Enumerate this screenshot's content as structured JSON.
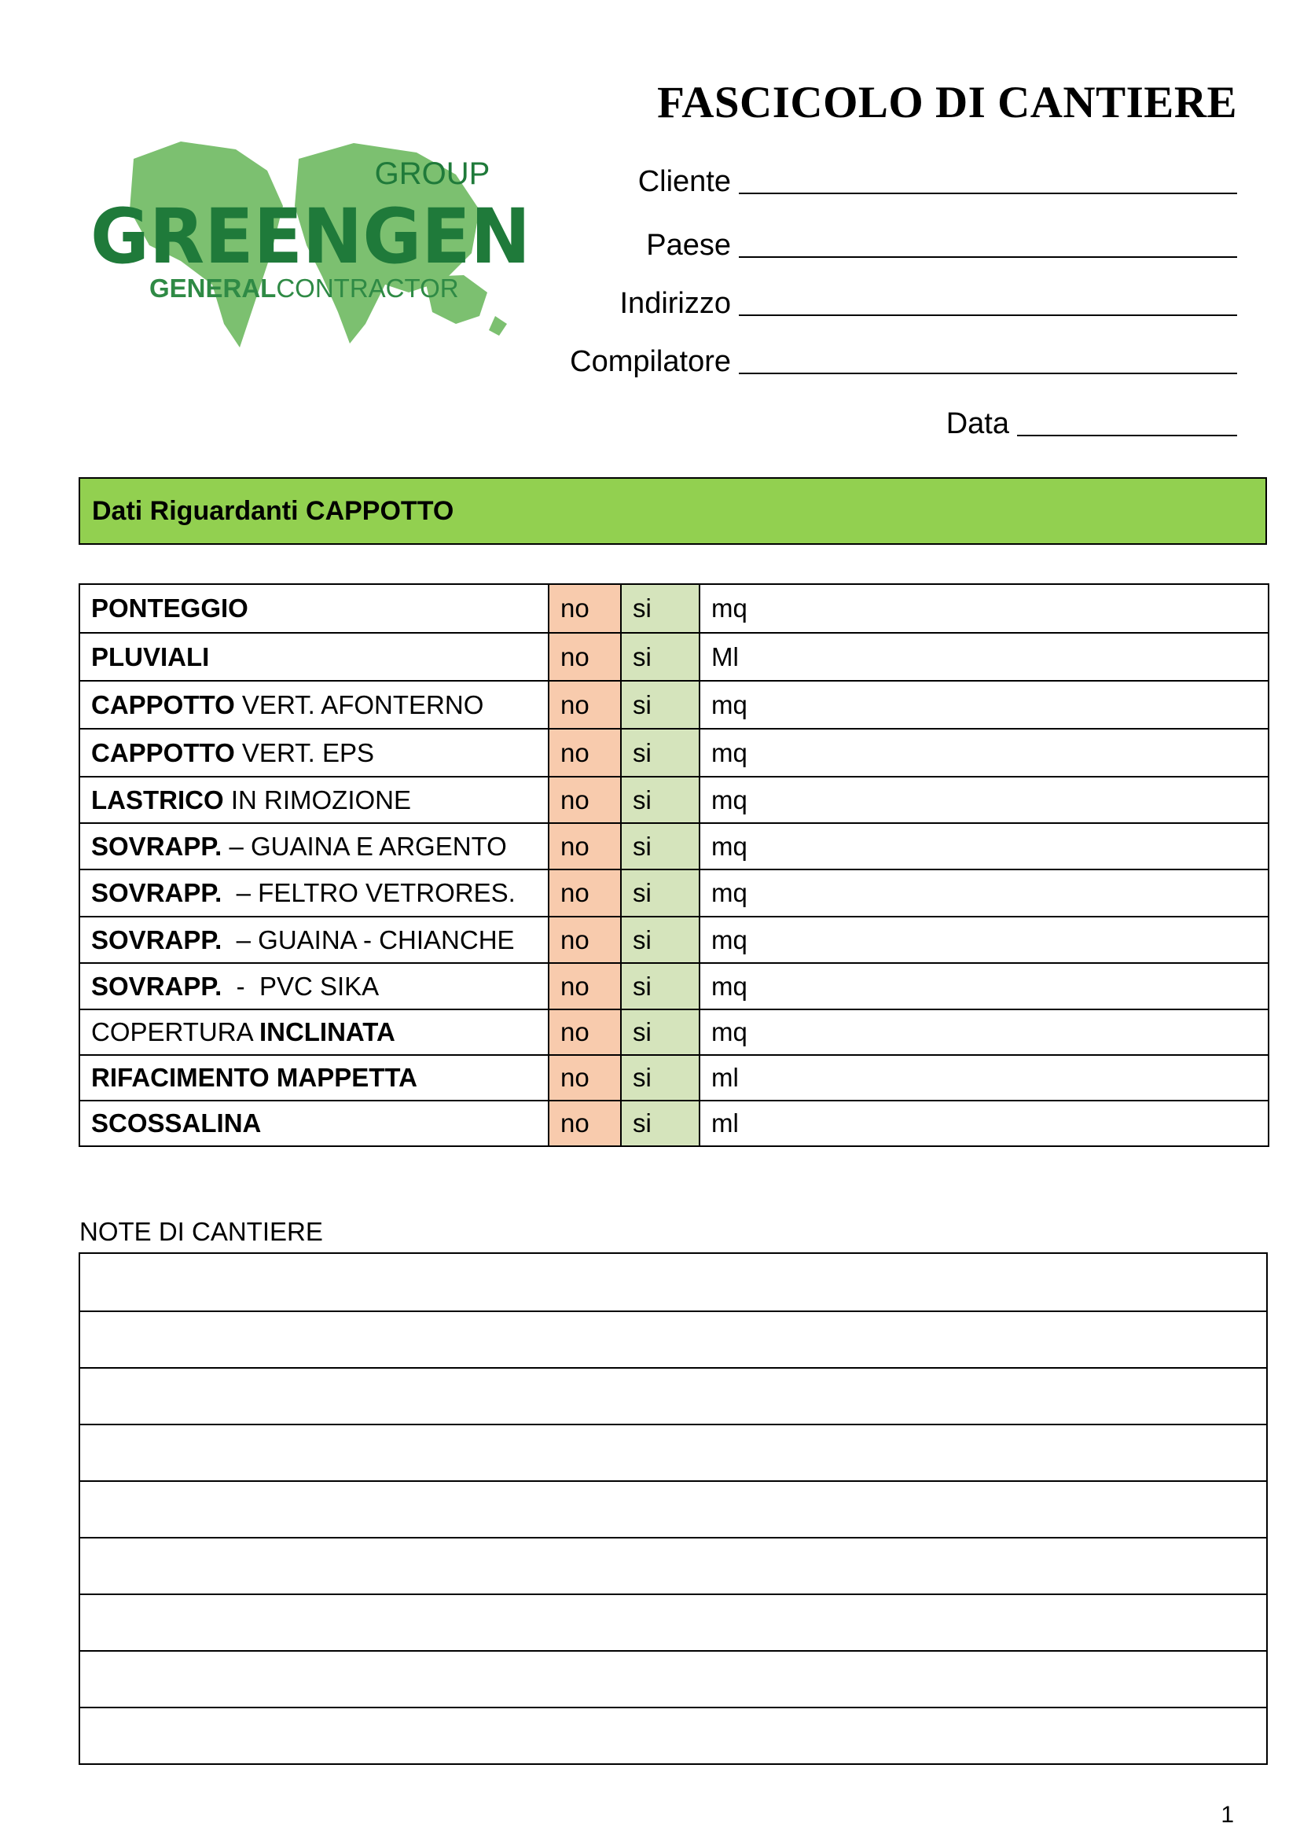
{
  "header": {
    "title": "FASCICOLO DI CANTIERE",
    "fields": [
      {
        "label": "Cliente"
      },
      {
        "label": "Paese"
      },
      {
        "label": "Indirizzo"
      },
      {
        "label": "Compilatore"
      }
    ],
    "date_label": "Data"
  },
  "logo": {
    "group": "GROUP",
    "name": "GREENGEN",
    "sub_bold": "GENERAL",
    "sub_light": "CONTRACTOR",
    "colors": {
      "map": "#7cc070",
      "text": "#1f7a3a",
      "sub": "#2f8a45"
    }
  },
  "section": {
    "title": "Dati Riguardanti CAPPOTTO"
  },
  "colors": {
    "section_bar": "#92d050",
    "no_cell": "#f8cbad",
    "si_cell": "#d5e4bc"
  },
  "items": [
    {
      "bold": "PONTEGGIO",
      "rest": "",
      "no": "no",
      "si": "si",
      "unit": "mq"
    },
    {
      "bold": "PLUVIALI",
      "rest": "",
      "no": "no",
      "si": "si",
      "unit": "Ml"
    },
    {
      "bold": "CAPPOTTO",
      "rest": " VERT. AFONTERNO",
      "no": "no",
      "si": "si",
      "unit": "mq"
    },
    {
      "bold": "CAPPOTTO",
      "rest": " VERT. EPS",
      "no": "no",
      "si": "si",
      "unit": "mq"
    },
    {
      "bold": "LASTRICO",
      "rest": " IN RIMOZIONE",
      "no": "no",
      "si": "si",
      "unit": "mq"
    },
    {
      "bold": "SOVRAPP.",
      "rest": " – GUAINA E ARGENTO",
      "no": "no",
      "si": "si",
      "unit": "mq"
    },
    {
      "bold": "SOVRAPP.",
      "rest": "  – FELTRO VETRORES.",
      "no": "no",
      "si": "si",
      "unit": "mq"
    },
    {
      "bold": "SOVRAPP.",
      "rest": "  – GUAINA - CHIANCHE",
      "no": "no",
      "si": "si",
      "unit": "mq"
    },
    {
      "bold": "SOVRAPP.",
      "rest": "  -  PVC SIKA",
      "no": "no",
      "si": "si",
      "unit": "mq"
    },
    {
      "pre": "COPERTURA ",
      "bold": "INCLINATA",
      "rest": "",
      "no": "no",
      "si": "si",
      "unit": "mq"
    },
    {
      "bold": "RIFACIMENTO MAPPETTA",
      "rest": "",
      "no": "no",
      "si": "si",
      "unit": "ml"
    },
    {
      "bold": "SCOSSALINA",
      "rest": "",
      "no": "no",
      "si": "si",
      "unit": "ml"
    }
  ],
  "notes": {
    "label": "NOTE DI CANTIERE",
    "lines": 9
  },
  "footer": {
    "page": "1"
  }
}
